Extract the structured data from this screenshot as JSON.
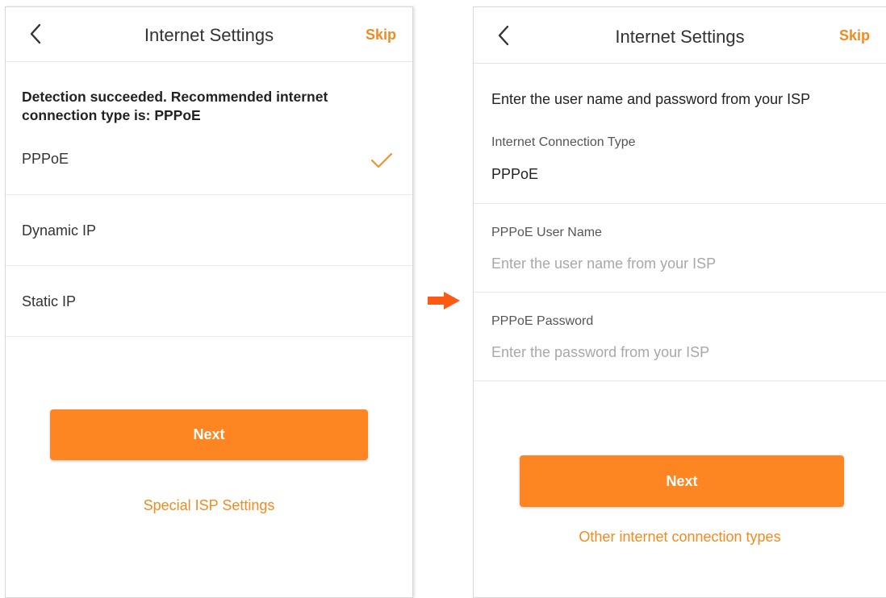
{
  "left_screen": {
    "title": "Internet Settings",
    "skip_label": "Skip",
    "detection_message": "Detection succeeded. Recommended internet connection type is: PPPoE",
    "options": [
      {
        "label": "PPPoE",
        "selected": true
      },
      {
        "label": "Dynamic IP",
        "selected": false
      },
      {
        "label": "Static IP",
        "selected": false
      }
    ],
    "next_label": "Next",
    "special_link": "Special ISP Settings"
  },
  "right_screen": {
    "title": "Internet Settings",
    "skip_label": "Skip",
    "intro": "Enter the user name and password from your ISP",
    "connection_type_label": "Internet Connection Type",
    "connection_type_value": "PPPoE",
    "username_label": "PPPoE User Name",
    "username_placeholder": "Enter the user name from your ISP",
    "username_value": "",
    "password_label": "PPPoE Password",
    "password_placeholder": "Enter the password from your ISP",
    "password_value": "",
    "next_label": "Next",
    "other_link": "Other internet connection types"
  },
  "icons": {
    "back": "chevron-left-icon",
    "check": "checkmark-icon",
    "flow_arrow": "arrow-right-icon"
  },
  "colors": {
    "accent": "#fd8623",
    "link": "#f28a22",
    "arrow": "#ff5a14"
  }
}
